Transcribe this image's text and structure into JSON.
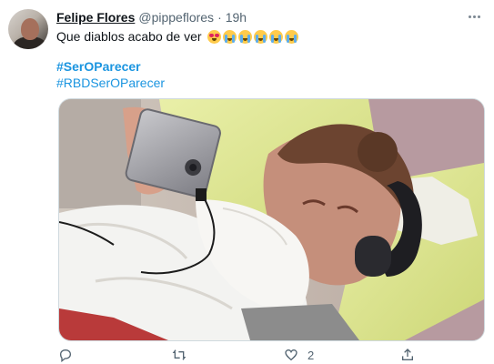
{
  "tweet": {
    "author_name": "Felipe Flores",
    "handle": "@pippeflores",
    "separator": "·",
    "time": "19h",
    "text": "Que diablos acabo de ver",
    "emojis": [
      "smiling-face-with-heart-eyes",
      "loudly-crying-face",
      "loudly-crying-face",
      "loudly-crying-face",
      "loudly-crying-face",
      "loudly-crying-face"
    ],
    "hashtags": [
      "#SerOParecer",
      "#RBDSerOParecer"
    ]
  },
  "actions": {
    "reply_icon": "reply-icon",
    "retweet_icon": "retweet-icon",
    "like_icon": "heart-icon",
    "like_count": "2",
    "share_icon": "share-icon"
  },
  "colors": {
    "link": "#1b95e0",
    "text": "#0f1419",
    "muted": "#536471"
  }
}
